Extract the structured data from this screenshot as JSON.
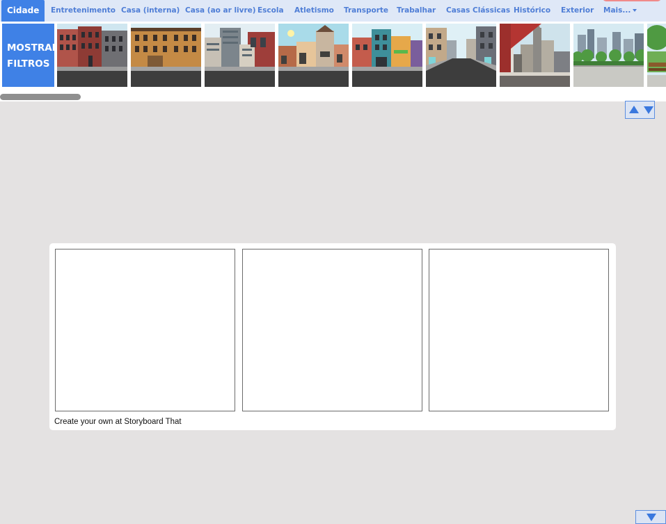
{
  "tabs": [
    {
      "label": "Cidade",
      "active": true
    },
    {
      "label": "Entretenimento"
    },
    {
      "label": "Casa (interna)"
    },
    {
      "label": "Casa (ao ar livre)"
    },
    {
      "label": "Escola"
    },
    {
      "label": "Atletismo"
    },
    {
      "label": "Transporte"
    },
    {
      "label": "Trabalhar"
    },
    {
      "label": "Casas Clássicas"
    },
    {
      "label": "Histórico"
    },
    {
      "label": "Exterior"
    },
    {
      "label": "Mais..."
    }
  ],
  "filter_button": {
    "label": "MOSTRAR\nFILTROS"
  },
  "scenes": [
    {
      "name": "brick-rowhouses-scene"
    },
    {
      "name": "victorian-townhouses-scene"
    },
    {
      "name": "downtown-buildings-scene"
    },
    {
      "name": "small-town-shops-scene"
    },
    {
      "name": "colorful-storefronts-scene"
    },
    {
      "name": "city-street-perspective-scene"
    },
    {
      "name": "window-skyline-view-scene"
    },
    {
      "name": "rooftop-park-scene"
    },
    {
      "name": "park-bench-scene"
    }
  ],
  "storyboard": {
    "cells": 3,
    "credit": "Create your own at Storyboard That"
  },
  "colors": {
    "accent": "#3f81e6",
    "tab_text": "#4f7ed6",
    "tab_bar": "#dfe8f7",
    "canvas": "#e4e2e2"
  }
}
